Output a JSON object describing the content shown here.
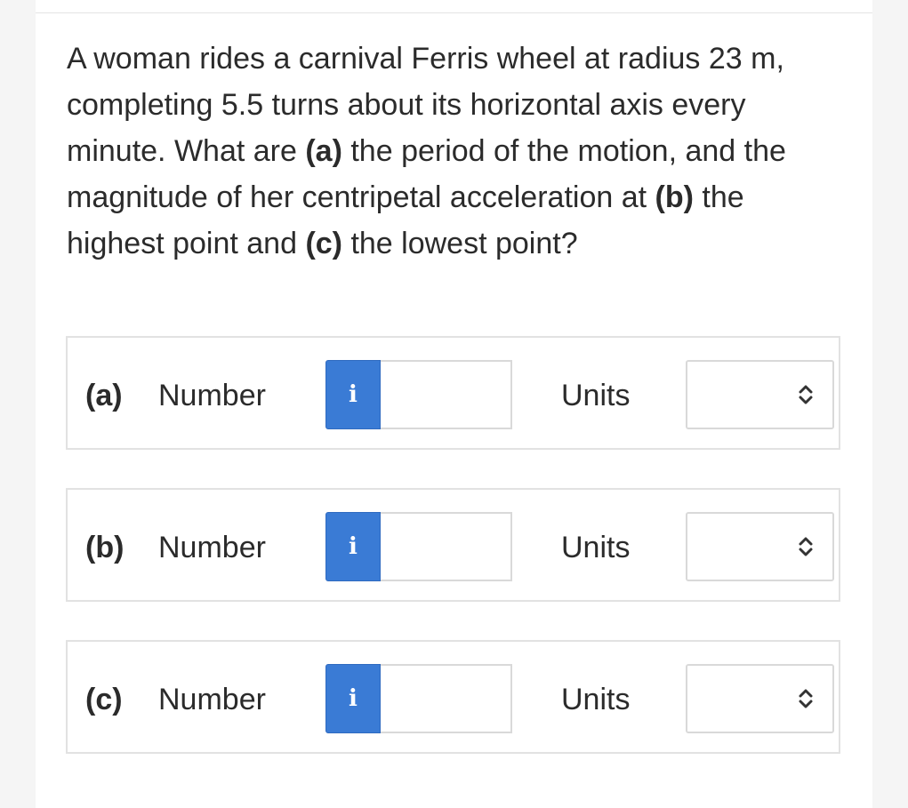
{
  "question": {
    "segments": [
      {
        "text": "A woman rides a carnival Ferris wheel at radius 23 m, completing 5.5 turns about its horizontal axis every minute. What are ",
        "bold": false
      },
      {
        "text": "(a)",
        "bold": true
      },
      {
        "text": " the period of the motion, and the magnitude of her centripetal acceleration at ",
        "bold": false
      },
      {
        "text": "(b)",
        "bold": true
      },
      {
        "text": " the highest point and ",
        "bold": false
      },
      {
        "text": "(c)",
        "bold": true
      },
      {
        "text": " the lowest point?",
        "bold": false
      }
    ]
  },
  "parts": [
    {
      "label": "(a)",
      "number_label": "Number",
      "info_icon": "i",
      "number_value": "",
      "units_label": "Units",
      "units_value": "",
      "chevron": "up-down-chevron-icon"
    },
    {
      "label": "(b)",
      "number_label": "Number",
      "info_icon": "i",
      "number_value": "",
      "units_label": "Units",
      "units_value": "",
      "chevron": "up-down-chevron-icon"
    },
    {
      "label": "(c)",
      "number_label": "Number",
      "info_icon": "i",
      "number_value": "",
      "units_label": "Units",
      "units_value": "",
      "chevron": "up-down-chevron-icon"
    }
  ],
  "colors": {
    "info_button": "#3a7bd5",
    "border": "#e2e2e2",
    "text": "#2b2b2b"
  }
}
